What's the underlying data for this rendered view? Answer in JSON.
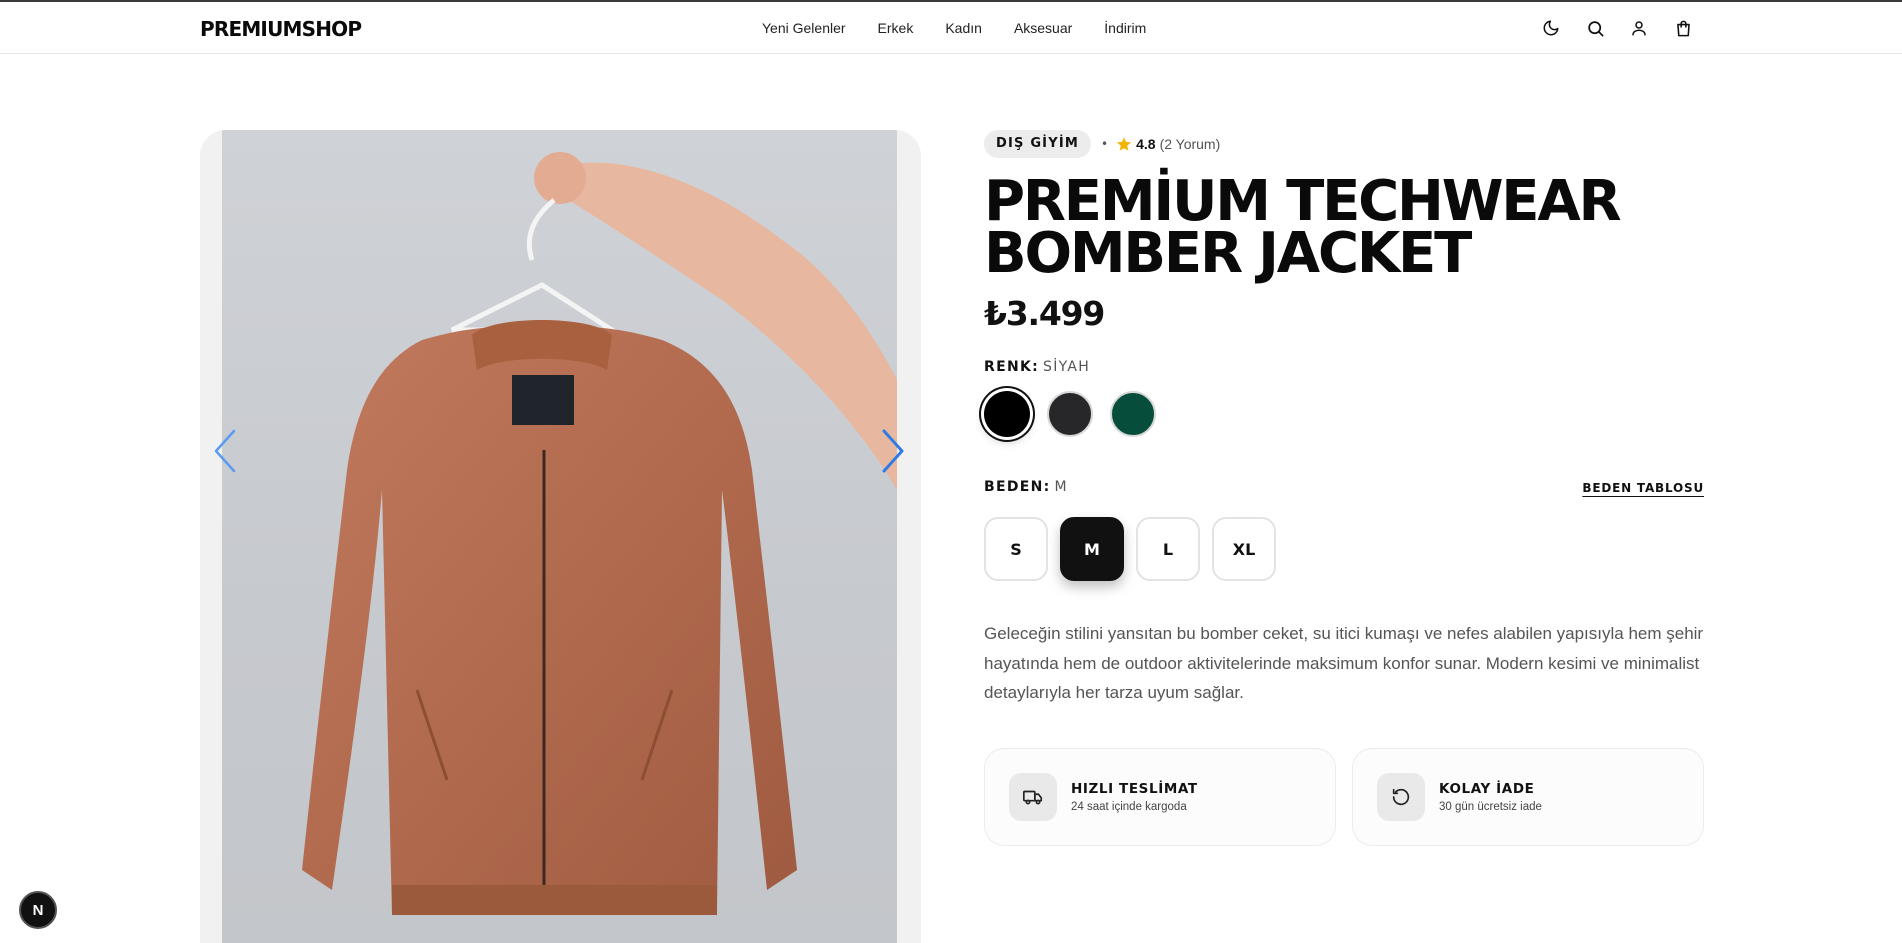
{
  "header": {
    "logo": "PREMIUMSHOP",
    "nav": [
      "Yeni Gelenler",
      "Erkek",
      "Kadın",
      "Aksesuar",
      "İndirim"
    ],
    "icons": [
      "moon-icon",
      "search-icon",
      "user-icon",
      "shopping-bag-icon"
    ]
  },
  "product": {
    "category": "DIŞ GİYİM",
    "rating": "4.8",
    "reviews": "(2 Yorum)",
    "title_line1": "PREMİUM TECHWEAR",
    "title_line2": "BOMBER JACKET",
    "price": "₺3.499",
    "color_label": "RENK:",
    "color_selected": "SİYAH",
    "colors": [
      "#000000",
      "#27272a",
      "#064e3b"
    ],
    "size_label": "BEDEN:",
    "size_selected": "M",
    "size_chart": "BEDEN TABLOSU",
    "sizes": [
      "S",
      "M",
      "L",
      "XL"
    ],
    "description": "Geleceğin stilini yansıtan bu bomber ceket, su itici kumaşı ve nefes alabilen yapısıyla hem şehir hayatında hem de outdoor aktivitelerinde maksimum konfor sunar. Modern kesimi ve minimalist detaylarıyla her tarza uyum sağlar."
  },
  "features": [
    {
      "title": "HIZLI TESLİMAT",
      "subtitle": "24 saat içinde kargoda",
      "icon": "truck-icon"
    },
    {
      "title": "KOLAY İADE",
      "subtitle": "30 gün ücretsiz iade",
      "icon": "return-icon"
    }
  ],
  "dev_badge": "N",
  "accent_color": "#3b82f6"
}
